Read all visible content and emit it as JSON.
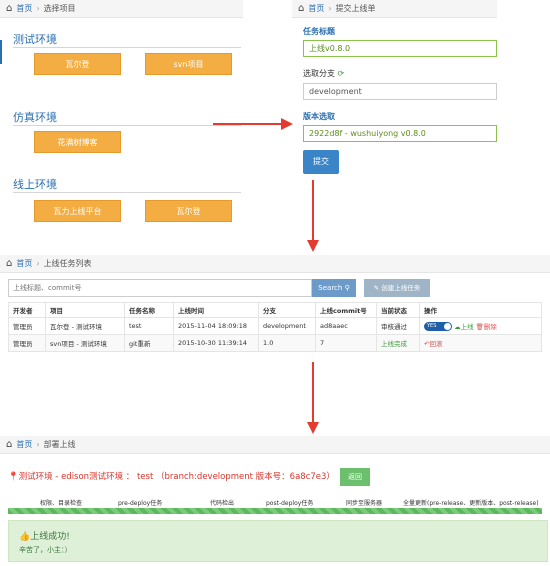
{
  "panel1": {
    "breadcrumb": {
      "home": "首页",
      "current": "选择项目"
    },
    "sections": [
      {
        "title": "测试环境",
        "buttons": [
          "瓦尔登",
          "svn项目"
        ]
      },
      {
        "title": "仿真环境",
        "buttons": [
          "花满树博客"
        ]
      },
      {
        "title": "线上环境",
        "buttons": [
          "瓦力上线平台",
          "瓦尔登"
        ]
      }
    ]
  },
  "panel2": {
    "breadcrumb": {
      "home": "首页",
      "current": "提交上线单"
    },
    "task_title_label": "任务标题",
    "task_title_value": "上线v0.8.0",
    "branch_label": "选取分支",
    "branch_value": "development",
    "version_label": "版本选取",
    "version_value": "2922d8f - wushuiyong v0.8.0",
    "submit_label": "提交"
  },
  "panel3": {
    "breadcrumb": {
      "home": "首页",
      "current": "上线任务列表"
    },
    "search_placeholder": "上线标题、commit号",
    "search_button": "Search",
    "create_button": "创建上线任务",
    "columns": [
      "开发者",
      "项目",
      "任务名称",
      "上线时间",
      "分支",
      "上线commit号",
      "当前状态",
      "操作"
    ],
    "rows": [
      {
        "dev": "管理员",
        "project": "瓦尔登 - 测试环境",
        "task": "test",
        "time": "2015-11-04 18:09:18",
        "branch": "development",
        "commit": "ad8aaec",
        "status": "审核通过",
        "toggle": "YES",
        "op1": "上线",
        "op2": "删除"
      },
      {
        "dev": "管理员",
        "project": "svn项目 - 测试环境",
        "task": "git重新",
        "time": "2015-10-30 11:39:14",
        "branch": "1.0",
        "commit": "7",
        "status": "上线完成",
        "op1": "回滚"
      }
    ]
  },
  "panel4": {
    "breadcrumb": {
      "home": "首页",
      "current": "部署上线"
    },
    "title": "测试环境 - edison测试环境 ： test （branch:development 版本号：6a8c7e3）",
    "back_button": "返回",
    "steps": [
      "权限、目录检查",
      "pre-deploy任务",
      "代码检出",
      "post-deploy任务",
      "同步至服务器",
      "全量更新(pre-release、更新版本、post-release)"
    ],
    "progress": 1.0,
    "success_title": "上线成功!",
    "success_text": "辛苦了，小主：）"
  },
  "colors": {
    "accent": "#2a6fb0",
    "orange": "#f4ad42",
    "arrow": "#e33b2e",
    "success": "#dff0d8",
    "progress": "#5cb85c"
  }
}
